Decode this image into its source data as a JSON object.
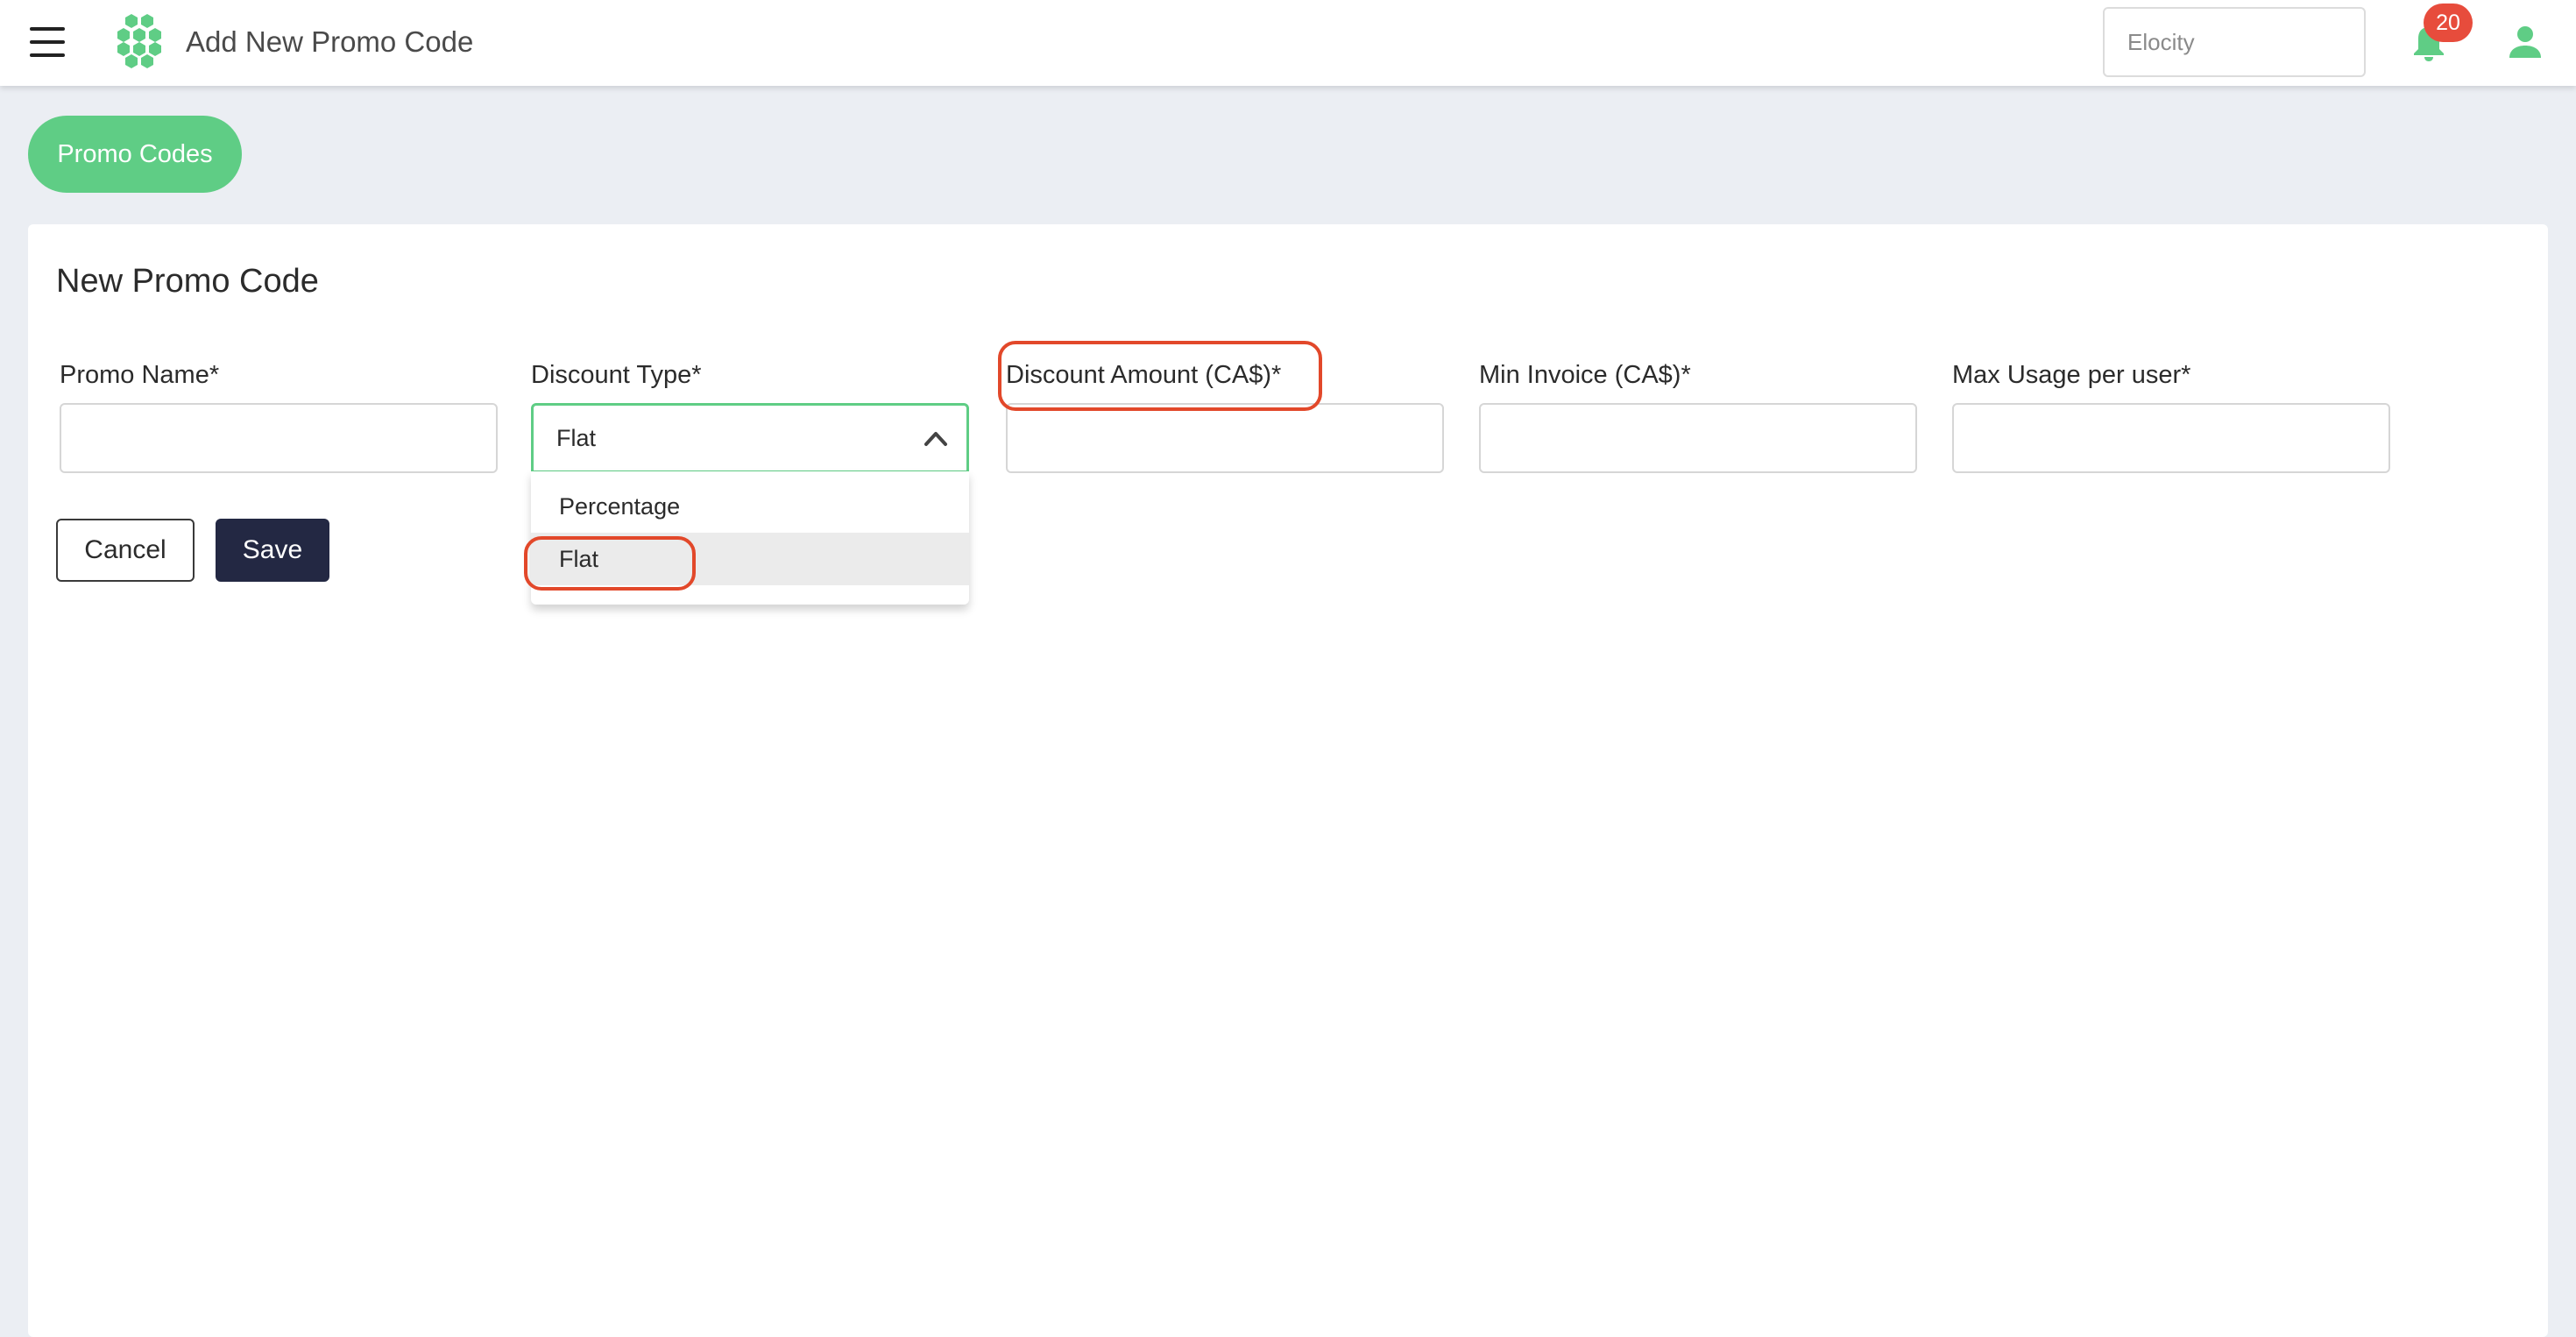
{
  "header": {
    "title": "Add New Promo Code",
    "site_selector": "Elocity",
    "notification_count": "20",
    "icons": {
      "menu": "hamburger-menu-icon",
      "logo": "hexagon-cluster-logo",
      "notifications": "bell-icon",
      "account": "user-icon"
    }
  },
  "breadcrumb": {
    "label": "Promo Codes"
  },
  "form": {
    "title": "New Promo Code",
    "fields": {
      "promo_name": {
        "label": "Promo Name*",
        "value": ""
      },
      "discount_type": {
        "label": "Discount Type*",
        "value": "Flat"
      },
      "discount_amount": {
        "label": "Discount Amount (CA$)*",
        "value": ""
      },
      "min_invoice": {
        "label": "Min Invoice (CA$)*",
        "value": ""
      },
      "max_usage": {
        "label": "Max Usage per user*",
        "value": ""
      }
    },
    "discount_type_options": [
      {
        "label": "Percentage",
        "selected": false
      },
      {
        "label": "Flat",
        "selected": true
      }
    ],
    "buttons": {
      "cancel": "Cancel",
      "save": "Save"
    }
  },
  "colors": {
    "accent_green": "#5fcd85",
    "save_button": "#232843",
    "badge_red": "#e74c3c",
    "annotation_red": "#e2482a",
    "page_background": "#ebeef3"
  }
}
